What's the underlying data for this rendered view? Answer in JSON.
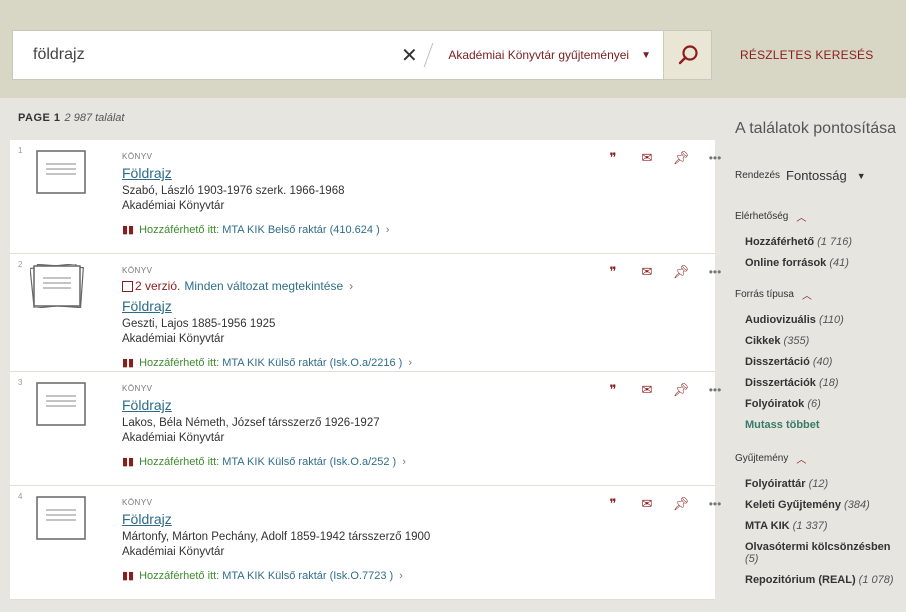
{
  "search": {
    "query": "földrajz",
    "clear_glyph": "✕",
    "scope": "Akadémiai Könyvtár gyűjteményei",
    "advanced": "RÉSZLETES KERESÉS"
  },
  "page": {
    "label": "PAGE 1",
    "count": "2 987 találat"
  },
  "results": [
    {
      "num": "1",
      "type": "KÖNYV",
      "title": "Földrajz",
      "author": "Szabó, László 1903-1976 szerk. 1966-1968",
      "publisher": "Akadémiai Könyvtár",
      "avail": "Hozzáférhető itt:",
      "location": "MTA KIK  Belső raktár (410.624 )",
      "icons": [
        "quote-icon",
        "mail-icon",
        "pin-icon",
        "more-icon"
      ]
    },
    {
      "num": "2",
      "type": "KÖNYV",
      "versions": "2 verzió.",
      "versions_link": "Minden változat megtekintése",
      "title": "Földrajz",
      "author": "Geszti, Lajos 1885-1956 1925",
      "publisher": "Akadémiai Könyvtár",
      "avail": "Hozzáférhető itt:",
      "location": "MTA KIK  Külső raktár (Isk.O.a/2216 )"
    },
    {
      "num": "3",
      "type": "KÖNYV",
      "title": "Földrajz",
      "author": "Lakos, Béla Németh, József társszerző 1926-1927",
      "publisher": "Akadémiai Könyvtár",
      "avail": "Hozzáférhető itt:",
      "location": "MTA KIK  Külső raktár (Isk.O.a/252 )"
    },
    {
      "num": "4",
      "type": "KÖNYV",
      "title": "Földrajz",
      "author": "Mártonfy, Márton Pechány, Adolf 1859-1942 társszerző 1900",
      "publisher": "Akadémiai Könyvtár",
      "avail": "Hozzáférhető itt:",
      "location": "MTA KIK  Külső raktár (Isk.O.7723 )"
    }
  ],
  "sidebar": {
    "heading": "A találatok pontosítása",
    "sort_label": "Rendezés",
    "sort_value": "Fontosság",
    "facets": {
      "availability": {
        "title": "Elérhetőség",
        "items": [
          {
            "label": "Hozzáférhető",
            "count": "(1 716)"
          },
          {
            "label": "Online források",
            "count": "(41)"
          }
        ]
      },
      "source_type": {
        "title": "Forrás típusa",
        "items": [
          {
            "label": "Audiovizuális",
            "count": "(110)"
          },
          {
            "label": "Cikkek",
            "count": "(355)"
          },
          {
            "label": "Disszertáció",
            "count": "(40)"
          },
          {
            "label": "Disszertációk",
            "count": "(18)"
          },
          {
            "label": "Folyóiratok",
            "count": "(6)"
          }
        ],
        "more": "Mutass többet"
      },
      "collection": {
        "title": "Gyűjtemény",
        "items": [
          {
            "label": "Folyóirattár",
            "count": "(12)"
          },
          {
            "label": "Keleti Gyűjtemény",
            "count": "(384)"
          },
          {
            "label": "MTA KIK",
            "count": "(1 337)"
          },
          {
            "label": "Olvasótermi kölcsönzésben",
            "count": "(5)"
          },
          {
            "label": "Repozitórium (REAL)",
            "count": "(1 078)"
          }
        ]
      }
    }
  },
  "colors": {
    "accent": "#8b1d1d",
    "link": "#2c6b88",
    "available": "#3e8a2e",
    "header": "#d8d6c5"
  }
}
